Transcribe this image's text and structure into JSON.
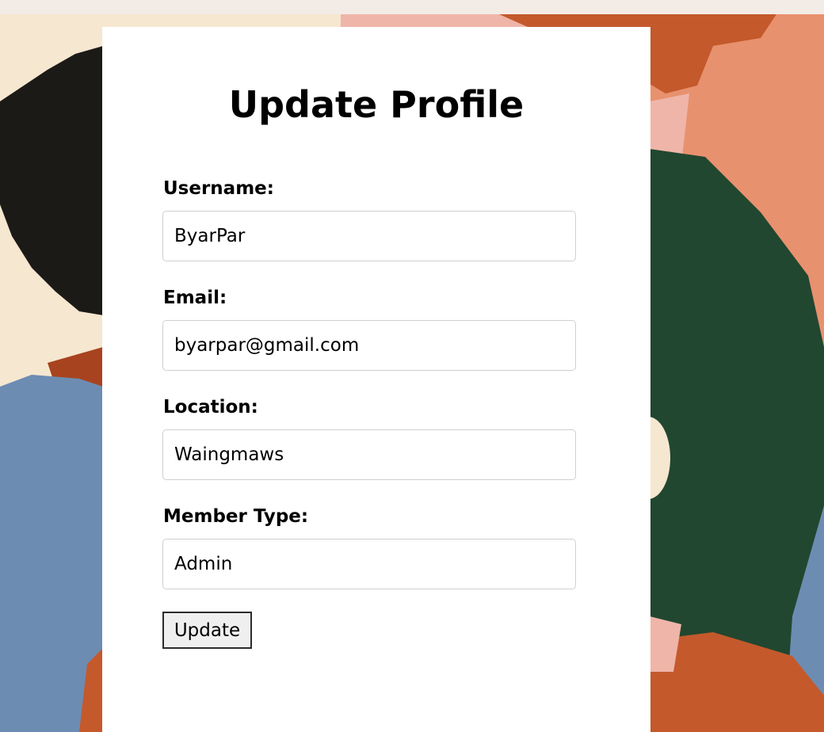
{
  "form": {
    "title": "Update Profile",
    "fields": [
      {
        "label": "Username:",
        "value": "ByarPar"
      },
      {
        "label": "Email:",
        "value": "byarpar@gmail.com"
      },
      {
        "label": "Location:",
        "value": "Waingmaws"
      },
      {
        "label": "Member Type:",
        "value": "Admin"
      }
    ],
    "submit_label": "Update"
  },
  "colors": {
    "page_bg": "#f3ebe5",
    "card_bg": "#ffffff",
    "illustration_cream": "#f6e7d0",
    "illustration_black": "#1b1a17",
    "illustration_blue": "#6d8cb2",
    "illustration_rust": "#c4592c",
    "illustration_peach": "#e8916e",
    "illustration_pink": "#efb5a9",
    "illustration_green": "#214730"
  }
}
